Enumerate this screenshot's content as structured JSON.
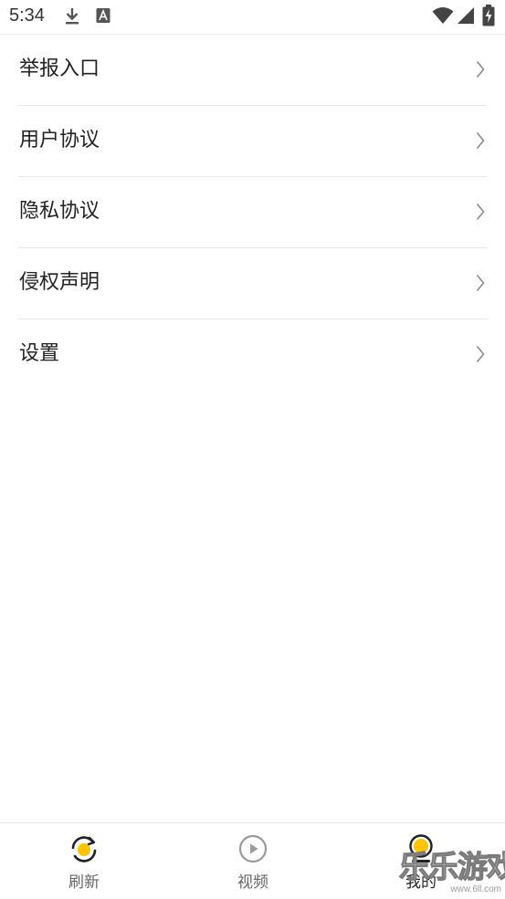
{
  "status_bar": {
    "time": "5:34",
    "icons": [
      "download-icon",
      "font-a-icon",
      "wifi-icon",
      "signal-icon",
      "battery-charging-icon"
    ]
  },
  "menu": {
    "items": [
      {
        "label": "举报入口",
        "icon": "chevron-right-icon"
      },
      {
        "label": "用户协议",
        "icon": "chevron-right-icon"
      },
      {
        "label": "隐私协议",
        "icon": "chevron-right-icon"
      },
      {
        "label": "侵权声明",
        "icon": "chevron-right-icon"
      },
      {
        "label": "设置",
        "icon": "chevron-right-icon"
      }
    ]
  },
  "bottom_nav": {
    "tabs": [
      {
        "label": "刷新",
        "icon": "refresh-icon",
        "active": false
      },
      {
        "label": "视频",
        "icon": "play-circle-icon",
        "active": false
      },
      {
        "label": "我的",
        "icon": "user-icon",
        "active": true
      }
    ]
  },
  "watermark": {
    "text": "乐乐游戏",
    "url": "www.6ll.com"
  },
  "colors": {
    "accent": "#FFC400",
    "text": "#222222",
    "inactive": "#888888",
    "divider": "#E7E7E7"
  }
}
